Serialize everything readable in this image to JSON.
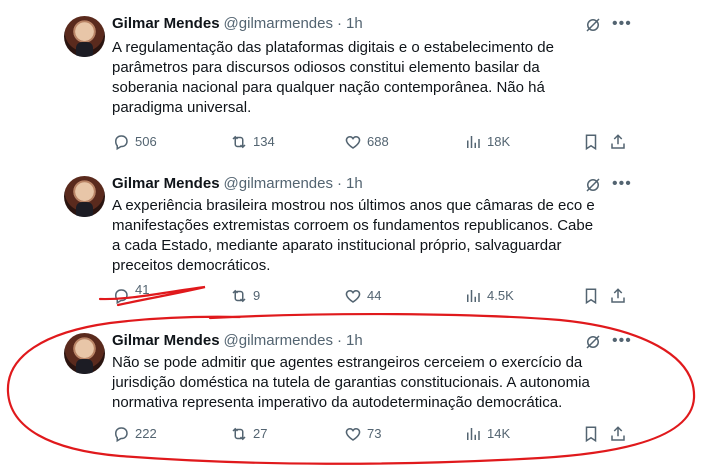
{
  "tweets": [
    {
      "name": "Gilmar Mendes",
      "handle": "@gilmarmendes",
      "separator": "·",
      "time": "1h",
      "text": "A regulamentação das plataformas digitais e o estabelecimento de parâmetros para discursos odiosos constitui elemento basilar da soberania nacional para qualquer nação contemporânea. Não há paradigma universal.",
      "replies": "506",
      "reposts": "134",
      "likes": "688",
      "views": "18K"
    },
    {
      "name": "Gilmar Mendes",
      "handle": "@gilmarmendes",
      "separator": "·",
      "time": "1h",
      "text": "A experiência brasileira mostrou nos últimos anos que câmaras de eco e manifestações extremistas corroem os fundamentos republicanos. Cabe a cada Estado, mediante aparato institucional próprio, salvaguardar preceitos democráticos.",
      "replies": "41",
      "reposts": "9",
      "likes": "44",
      "views": "4.5K"
    },
    {
      "name": "Gilmar Mendes",
      "handle": "@gilmarmendes",
      "separator": "·",
      "time": "1h",
      "text": "Não se pode admitir que agentes estrangeiros cerceiem o exercício da jurisdição doméstica na tutela de garantias constitucionais. A autonomia normativa representa imperativo da autodeterminação democrática.",
      "replies": "222",
      "reposts": "27",
      "likes": "73",
      "views": "14K"
    }
  ],
  "colors": {
    "text": "#0f1419",
    "muted": "#536471",
    "annotation": "#e0191c"
  },
  "icons": [
    "grok-icon",
    "more-icon",
    "reply-icon",
    "repost-icon",
    "like-icon",
    "views-icon",
    "bookmark-icon",
    "share-icon"
  ]
}
